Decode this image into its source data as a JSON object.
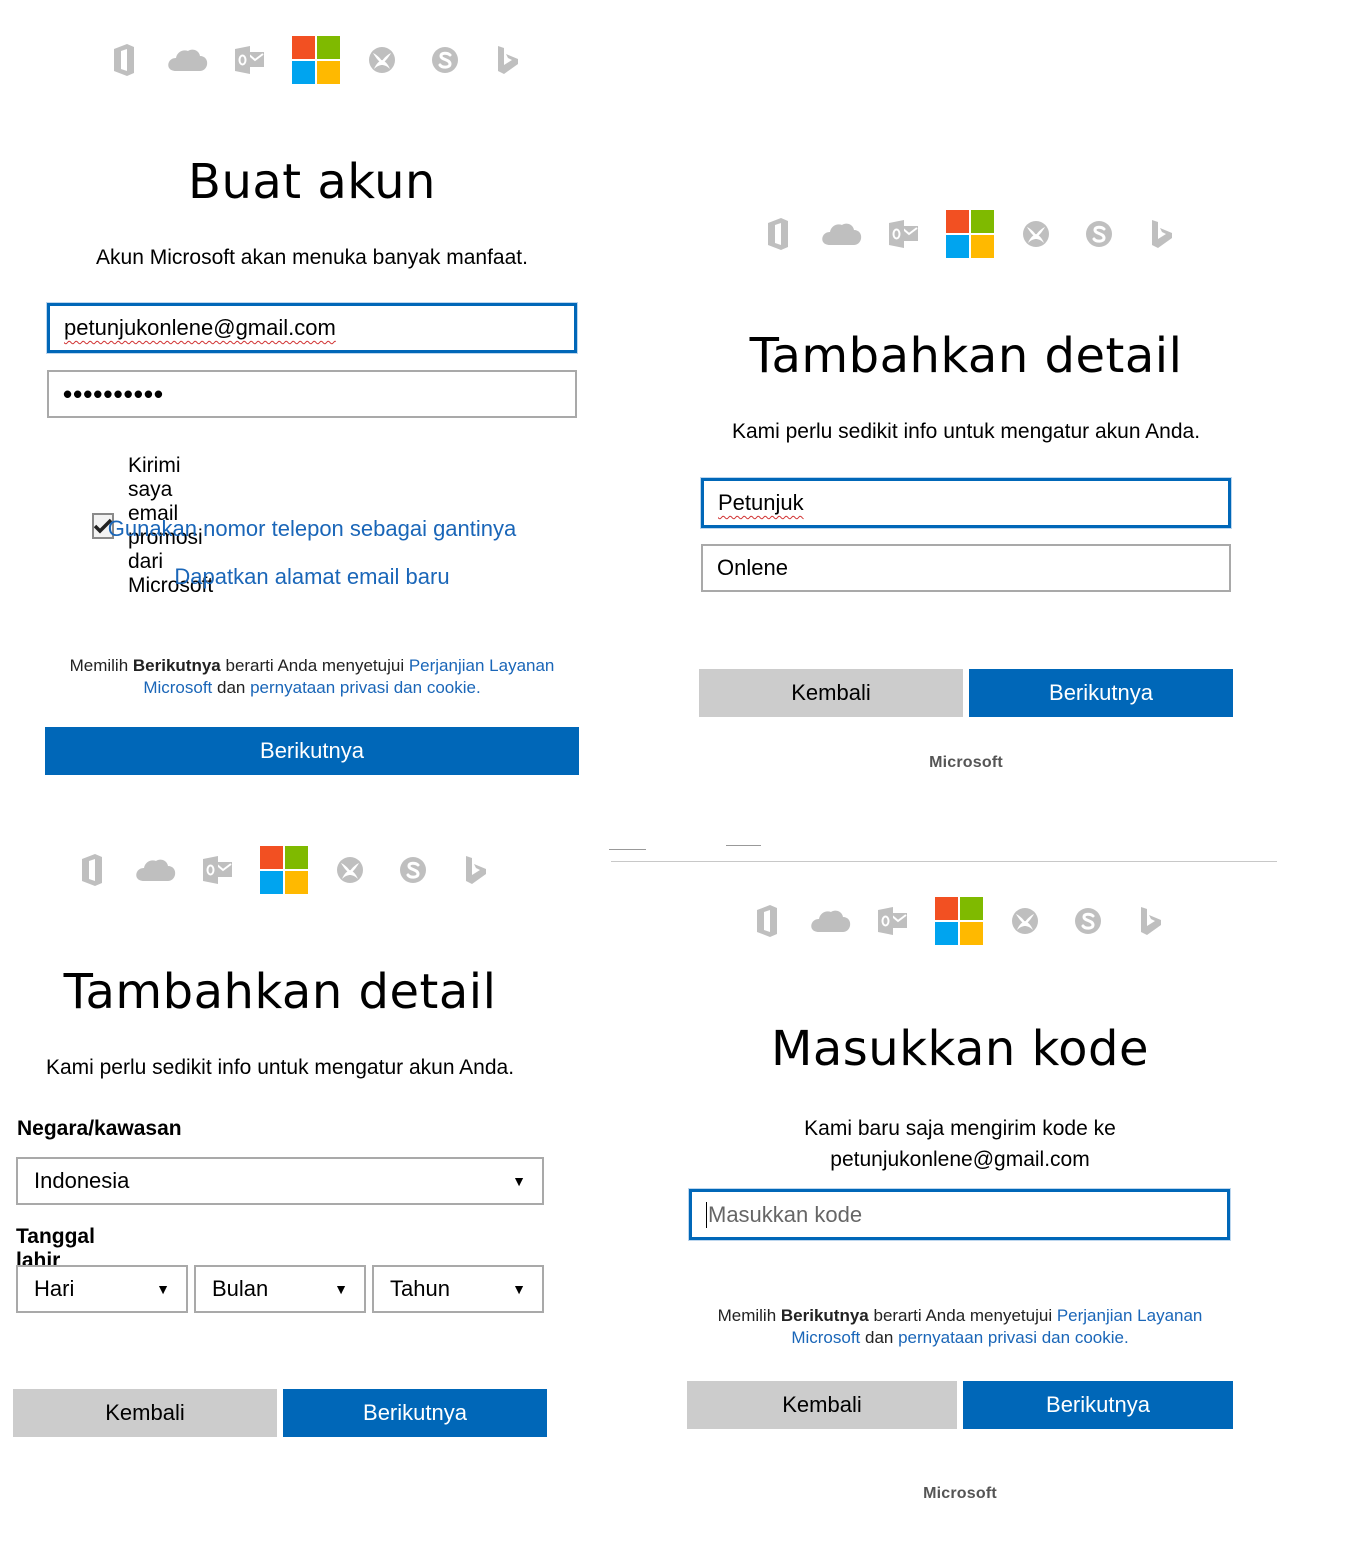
{
  "brand": {
    "colors": {
      "red": "#f25022",
      "green": "#7fba00",
      "blue": "#00a4ef",
      "yellow": "#ffb900",
      "accent": "#0067b8",
      "link": "#1a66b8",
      "icon_gray": "#bfbfbf"
    },
    "icons": [
      "office-icon",
      "onedrive-icon",
      "outlook-icon",
      "microsoft-logo",
      "xbox-icon",
      "skype-icon",
      "bing-icon"
    ]
  },
  "panel1": {
    "title": "Buat akun",
    "subtitle": "Akun Microsoft akan menuka banyak manfaat.",
    "email_value": "petunjukonlene@gmail.com",
    "password_value": "••••••••••",
    "promo_checked": true,
    "promo_label": "Kirimi saya email promosi dari Microsoft",
    "phone_link": "Gunakan nomor telepon sebagai gantinya",
    "new_email_link": "Dapatkan alamat email baru",
    "legal": {
      "prefix": "Memilih ",
      "bold": "Berikutnya",
      "middle": " berarti Anda menyetujui ",
      "link1": "Perjanjian Layanan Microsoft",
      "and": " dan ",
      "link2": "pernyataan privasi dan cookie."
    },
    "next_label": "Berikutnya"
  },
  "panel2": {
    "title": "Tambahkan detail",
    "subtitle": "Kami perlu sedikit info untuk mengatur akun Anda.",
    "first_name_value": "Petunjuk",
    "last_name_value": "Onlene",
    "back_label": "Kembali",
    "next_label": "Berikutnya",
    "footer": "Microsoft"
  },
  "panel3": {
    "title": "Tambahkan detail",
    "subtitle": "Kami perlu sedikit info untuk mengatur akun Anda.",
    "country_label": "Negara/kawasan",
    "country_value": "Indonesia",
    "birthdate_label": "Tanggal lahir",
    "day_value": "Hari",
    "month_value": "Bulan",
    "year_value": "Tahun",
    "back_label": "Kembali",
    "next_label": "Berikutnya"
  },
  "panel4": {
    "title": "Masukkan kode",
    "subtitle_line1": "Kami baru saja mengirim kode ke",
    "subtitle_line2": "petunjukonlene@gmail.com",
    "code_placeholder": "Masukkan kode",
    "legal": {
      "prefix": "Memilih ",
      "bold": "Berikutnya",
      "middle": " berarti Anda menyetujui ",
      "link1": "Perjanjian Layanan Microsoft",
      "and": " dan ",
      "link2": "pernyataan privasi dan cookie."
    },
    "back_label": "Kembali",
    "next_label": "Berikutnya",
    "footer": "Microsoft"
  }
}
